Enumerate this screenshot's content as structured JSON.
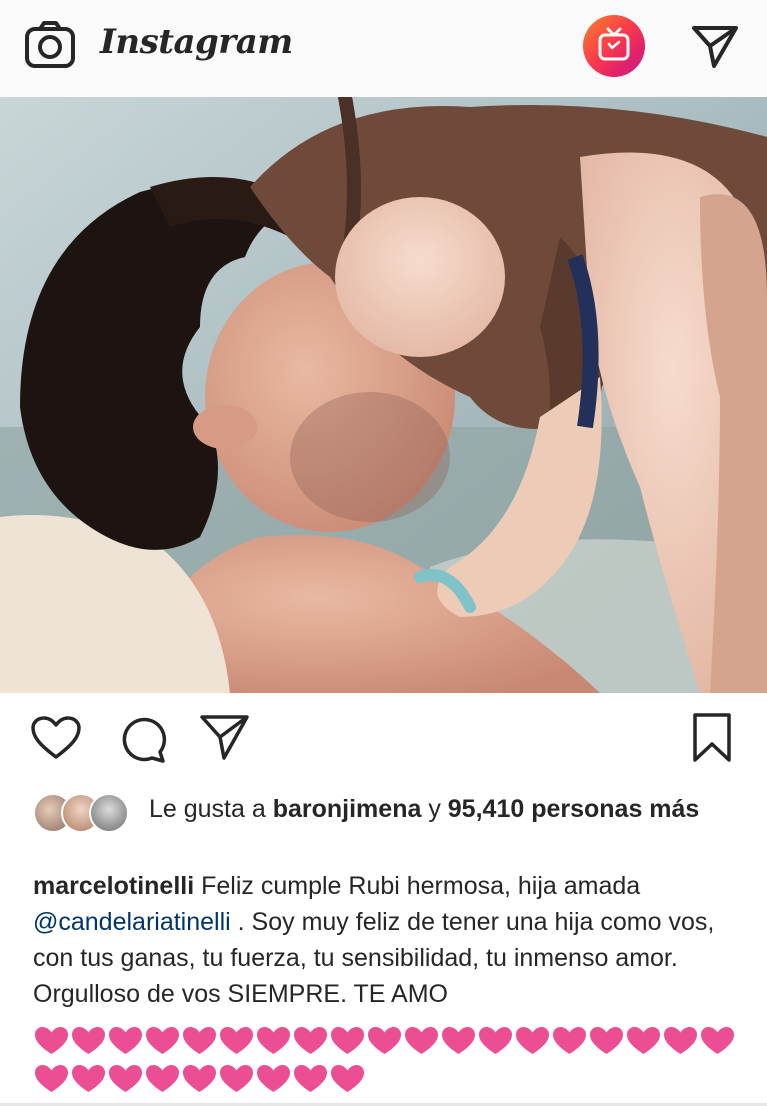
{
  "app": {
    "brand": "Instagram",
    "icons": [
      "camera-icon",
      "igtv-icon",
      "direct-message-icon"
    ]
  },
  "post": {
    "image_alt": "Photo",
    "actions": {
      "icons": [
        "heart-icon",
        "comment-icon",
        "share-icon",
        "bookmark-icon"
      ]
    },
    "likes": {
      "prefix": "Le gusta a ",
      "first_user": "baronjimena",
      "connector": " y ",
      "count_text": "95,410 personas más"
    },
    "caption": {
      "username": "marcelotinelli",
      "text_1": " Feliz cumple Rubi hermosa, hija amada ",
      "mention": "@candelariatinelli",
      "text_2": " . Soy muy feliz de tener una hija como vos, con tus ganas, tu fuerza, tu sensibilidad, tu inmenso amor. Orgulloso de vos SIEMPRE. TE AMO"
    },
    "hearts": {
      "row_1_count": 19,
      "row_2_count": 9,
      "color": "#ec4e93"
    }
  },
  "colors": {
    "text": "#262626",
    "mention": "#003569",
    "igtv_gradient_start": "#f58529",
    "igtv_gradient_end": "#bc2a8d"
  }
}
